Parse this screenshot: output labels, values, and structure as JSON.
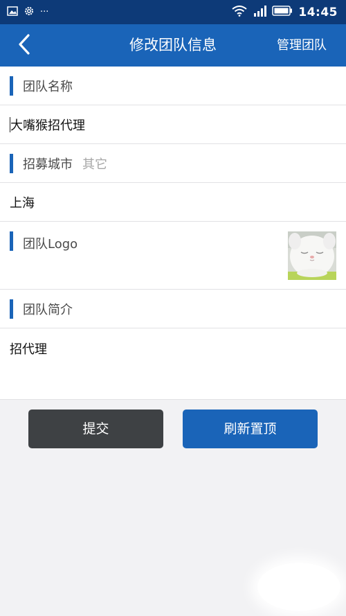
{
  "status_bar": {
    "time": "14:45",
    "more": "···",
    "left_icons": [
      "image-icon",
      "settings-gear-icon"
    ],
    "right_icons": [
      "wifi-icon",
      "cellular-signal-icon",
      "battery-icon"
    ]
  },
  "nav": {
    "title": "修改团队信息",
    "action": "管理团队",
    "back_icon": "chevron-left-icon"
  },
  "form": {
    "team_name": {
      "label": "团队名称",
      "value": "大嘴猴招代理"
    },
    "city": {
      "label": "招募城市",
      "sub": "其它",
      "value": "上海"
    },
    "logo": {
      "label": "团队Logo"
    },
    "intro": {
      "label": "团队简介",
      "value": "招代理"
    }
  },
  "buttons": {
    "submit": "提交",
    "refresh_top": "刷新置顶"
  },
  "colors": {
    "status_bar": "#0d3a78",
    "primary": "#1a64b8",
    "dark_button": "#3e4144",
    "background": "#f2f2f4"
  }
}
